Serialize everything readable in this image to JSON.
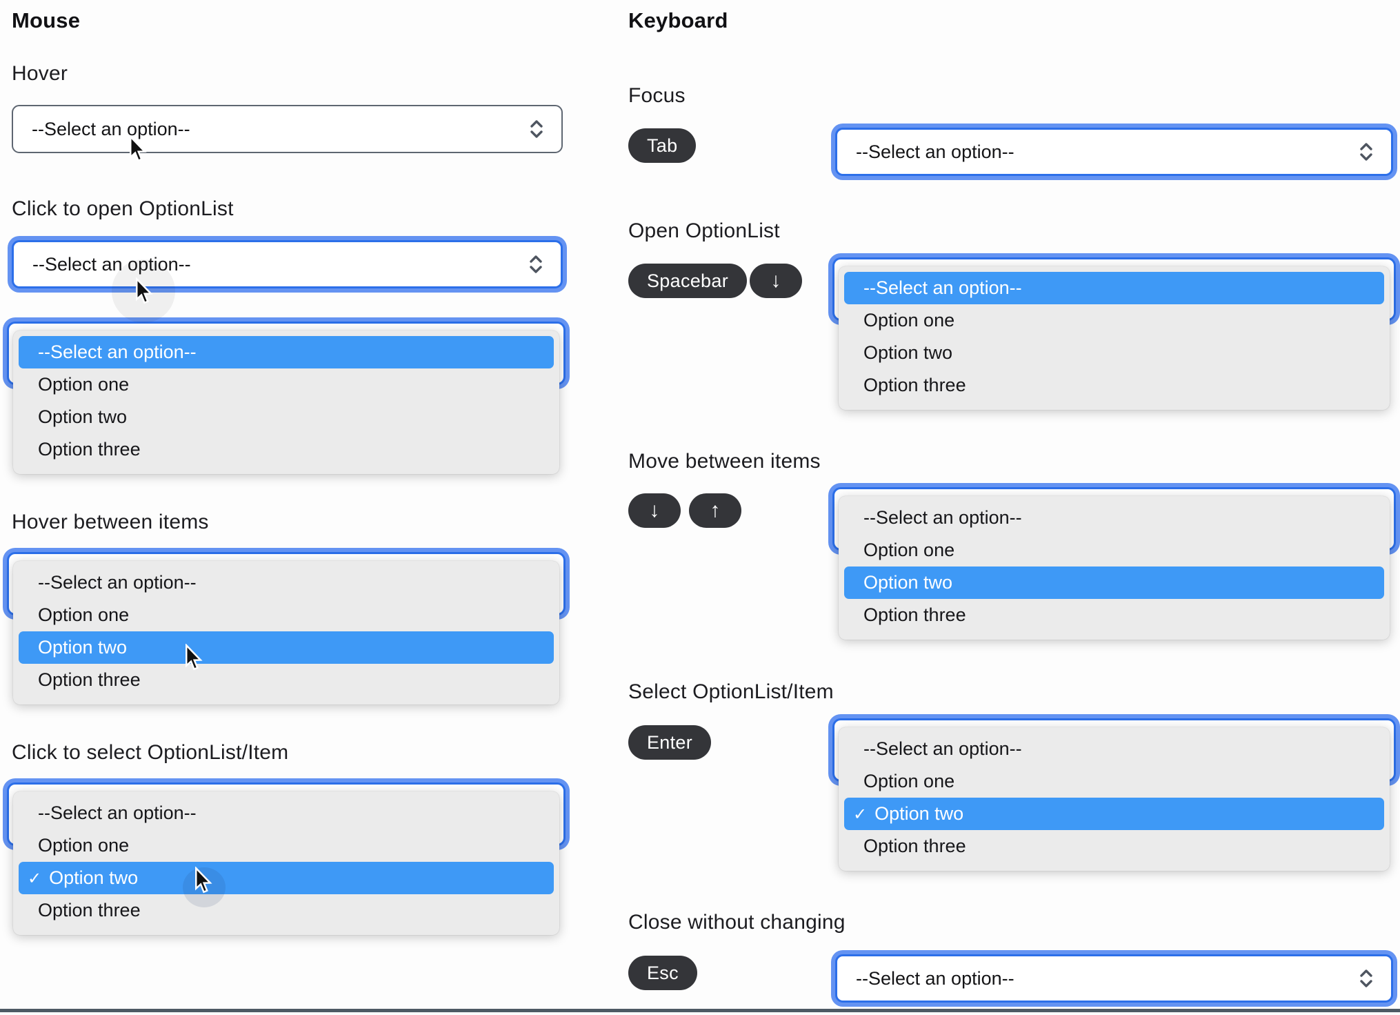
{
  "titles": {
    "mouse": "Mouse",
    "keyboard": "Keyboard"
  },
  "select_placeholder": "--Select an option--",
  "option_items": [
    "--Select an option--",
    "Option one",
    "Option two",
    "Option three"
  ],
  "checkmark": "✓",
  "mouse_sections": {
    "hover": "Hover",
    "click_open": "Click to open OptionList",
    "hover_items": "Hover between items",
    "click_select": "Click to select OptionList/Item"
  },
  "keyboard_sections": {
    "focus": "Focus",
    "open": "Open OptionList",
    "move": "Move between items",
    "select": "Select OptionList/Item",
    "close": "Close without changing"
  },
  "keys": {
    "tab": "Tab",
    "spacebar": "Spacebar",
    "arrow_down": "↓",
    "arrow_up": "↑",
    "enter": "Enter",
    "esc": "Esc"
  },
  "lists": {
    "mouse_click_open": {
      "highlighted": 0,
      "checked": -1
    },
    "mouse_hover_items": {
      "highlighted": 2,
      "checked": -1
    },
    "mouse_click_select": {
      "highlighted": 2,
      "checked": 2
    },
    "kb_open": {
      "highlighted": 0,
      "checked": -1
    },
    "kb_move": {
      "highlighted": 2,
      "checked": -1
    },
    "kb_select": {
      "highlighted": 2,
      "checked": 2
    }
  },
  "colors": {
    "highlight_blue": "#3e99f6",
    "focus_ring_inner": "#2c6fe9",
    "focus_ring_outer": "#6493f2",
    "select_border_gray": "#5e6671",
    "panel_gray": "#ebebeb",
    "badge_dark": "#343539",
    "bottom_line": "#4e5a64"
  }
}
